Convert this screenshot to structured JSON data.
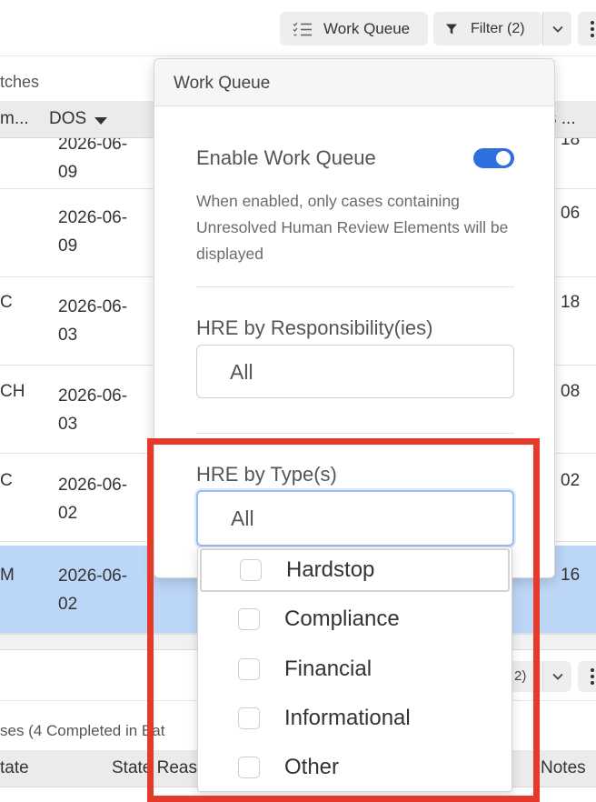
{
  "toolbar": {
    "work_queue_label": "Work Queue",
    "filter_label": "Filter (2)"
  },
  "table1": {
    "title": "tches",
    "headers": {
      "col1": "m...",
      "col2": "DOS",
      "col3": "s ..."
    },
    "rows": [
      {
        "a": "",
        "dos_line1": "2026-06-",
        "dos_line2": "09",
        "e": "18"
      },
      {
        "a": "",
        "dos_line1": "2026-06-",
        "dos_line2": "09",
        "e": "06"
      },
      {
        "a": "C",
        "dos_line1": "2026-06-",
        "dos_line2": "03",
        "e": "18"
      },
      {
        "a": "CH",
        "dos_line1": "2026-06-",
        "dos_line2": "03",
        "e": "08"
      },
      {
        "a": "C",
        "dos_line1": "2026-06-",
        "dos_line2": "02",
        "e": "02"
      },
      {
        "a": "M",
        "dos_line1": "2026-06-",
        "dos_line2": "02",
        "e": "16"
      }
    ]
  },
  "table2": {
    "toolbar_fragment": "2)",
    "title": "ses (4 Completed in Bat",
    "headers": {
      "col1": "tate",
      "col2": "State Reas",
      "col3": "Notes"
    }
  },
  "popover": {
    "title": "Work Queue",
    "enable_label": "Enable Work Queue",
    "enable_on": true,
    "enable_description": "When enabled, only cases containing Unresolved Human Review Elements will be displayed",
    "responsibility_label": "HRE by Responsibility(ies)",
    "responsibility_value": "All",
    "type_label": "HRE by Type(s)",
    "type_value": "All"
  },
  "type_options": [
    {
      "label": "Hardstop",
      "checked": false
    },
    {
      "label": "Compliance",
      "checked": false
    },
    {
      "label": "Financial",
      "checked": false
    },
    {
      "label": "Informational",
      "checked": false
    },
    {
      "label": "Other",
      "checked": false
    }
  ],
  "colors": {
    "accent": "#2f6fe0",
    "selected_row": "#bcd6f7",
    "highlight": "#e5392a"
  }
}
